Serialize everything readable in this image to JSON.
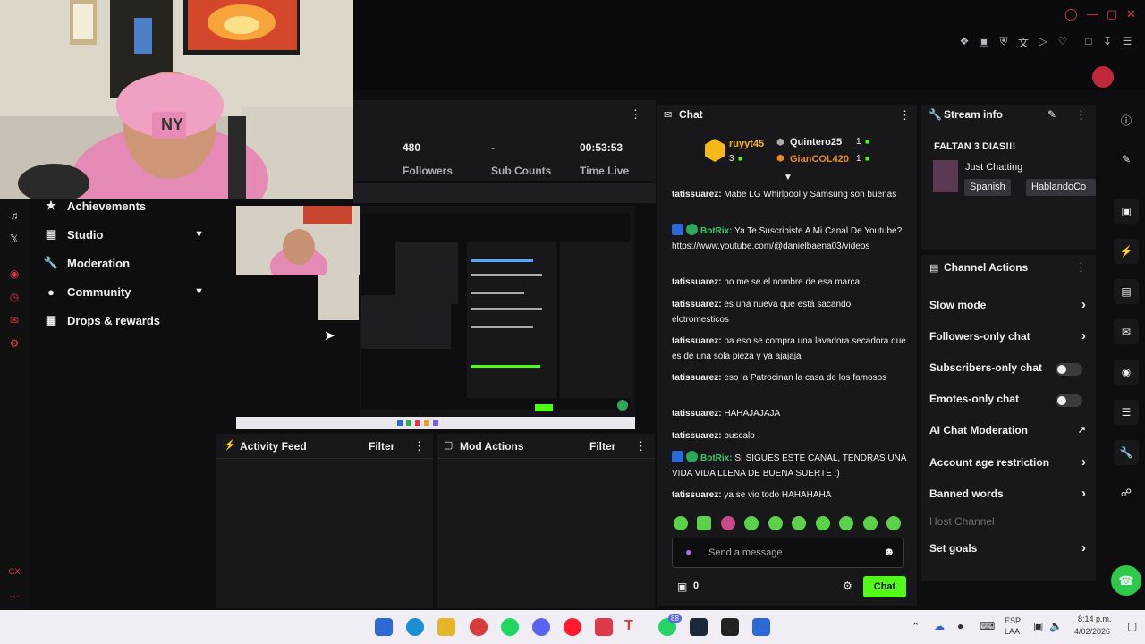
{
  "stats": {
    "followers_value": "480",
    "followers_label": "Followers",
    "subs_value": "-",
    "subs_label": "Sub Counts",
    "time_value": "00:53:53",
    "time_label": "Time Live"
  },
  "sidebar": {
    "items": [
      {
        "label": "Achievements"
      },
      {
        "label": "Studio"
      },
      {
        "label": "Moderation"
      },
      {
        "label": "Community"
      },
      {
        "label": "Drops & rewards"
      }
    ]
  },
  "activity_feed": {
    "title": "Activity Feed",
    "filter": "Filter"
  },
  "mod_actions": {
    "title": "Mod Actions",
    "filter": "Filter"
  },
  "chat": {
    "title": "Chat",
    "leaderboard": {
      "first_name": "ruyyt45",
      "first_count": "3",
      "second_name": "Quintero25",
      "second_count": "1",
      "third_name": "GianCOL420",
      "third_count": "1"
    },
    "messages": [
      {
        "user": "tatissuarez:",
        "text": "Mabe LG Whirlpool y Samsung son buenas"
      },
      {
        "user": "BotRix:",
        "text": "Ya Te Suscribiste A Mi Canal De Youtube?",
        "link": "https://www.youtube.com/@danielbaena03/videos"
      },
      {
        "user": "tatissuarez:",
        "text": "no me se el nombre de esa marca"
      },
      {
        "user": "tatissuarez:",
        "text": "es una nueva que está sacando elctromesticos"
      },
      {
        "user": "tatissuarez:",
        "text": "pa eso se compra una lavadora secadora que es de una sola pieza y ya ajajaja"
      },
      {
        "user": "tatissuarez:",
        "text": "eso la Patrocinan la casa de los famosos"
      },
      {
        "user": "tatissuarez:",
        "text": "HAHAJAJAJA"
      },
      {
        "user": "tatissuarez:",
        "text": "buscalo"
      },
      {
        "user": "BotRix:",
        "text": "SI SIGUES ESTE CANAL, TENDRAS UNA VIDA VIDA LLENA DE BUENA SUERTE :)"
      },
      {
        "user": "tatissuarez:",
        "text": "ya se vio todo HAHAHAHA"
      }
    ],
    "placeholder": "Send a message",
    "points": "0",
    "chat_button": "Chat"
  },
  "stream_info": {
    "title": "Stream info",
    "stream_title": "FALTAN 3 DIAS!!!",
    "category": "Just Chatting",
    "tags": [
      "Spanish",
      "HablandoCo"
    ]
  },
  "channel_actions": {
    "title": "Channel Actions",
    "items": [
      {
        "label": "Slow mode"
      },
      {
        "label": "Followers-only chat"
      },
      {
        "label": "Subscribers-only chat"
      },
      {
        "label": "Emotes-only chat"
      },
      {
        "label": "AI Chat Moderation"
      },
      {
        "label": "Account age restriction"
      },
      {
        "label": "Banned words"
      },
      {
        "label": "Host Channel"
      },
      {
        "label": "Set goals"
      }
    ]
  },
  "taskbar": {
    "lang_top": "ESP",
    "lang_bottom": "LAA",
    "time": "8:14 p.m.",
    "date": "4/02/2026",
    "whatsapp_badge": "88"
  },
  "colors": {
    "accent_green": "#53fc18",
    "background": "#0e0e10",
    "panel": "#18181b"
  }
}
